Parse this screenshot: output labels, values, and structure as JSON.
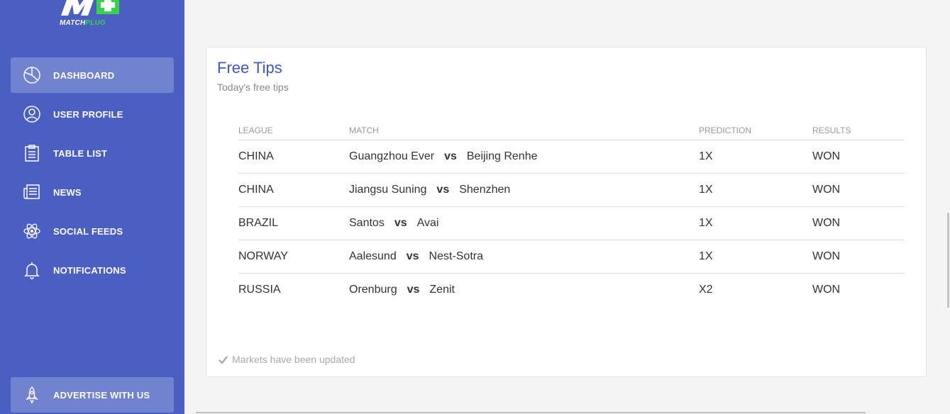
{
  "brand": {
    "logo_letters": "M",
    "name_part1": "MATCH",
    "name_part2": "PLUG"
  },
  "sidebar": {
    "items": [
      {
        "label": "DASHBOARD",
        "icon": "pie-chart-icon",
        "active": true
      },
      {
        "label": "USER PROFILE",
        "icon": "user-icon",
        "active": false
      },
      {
        "label": "TABLE LIST",
        "icon": "clipboard-icon",
        "active": false
      },
      {
        "label": "NEWS",
        "icon": "newspaper-icon",
        "active": false
      },
      {
        "label": "SOCIAL FEEDS",
        "icon": "atom-icon",
        "active": false
      },
      {
        "label": "NOTIFICATIONS",
        "icon": "bell-icon",
        "active": false
      }
    ],
    "advertise": {
      "label": "ADVERTISE WITH US",
      "icon": "rocket-icon"
    }
  },
  "card": {
    "title": "Free Tips",
    "subtitle": "Today's free tips",
    "columns": [
      "LEAGUE",
      "MATCH",
      "PREDICTION",
      "RESULTS"
    ],
    "rows": [
      {
        "league": "CHINA",
        "home": "Guangzhou Ever",
        "vs": "vs",
        "away": "Beijing Renhe",
        "prediction": "1X",
        "result": "WON"
      },
      {
        "league": "CHINA",
        "home": "Jiangsu Suning",
        "vs": "vs",
        "away": "Shenzhen",
        "prediction": "1X",
        "result": "WON"
      },
      {
        "league": "BRAZIL",
        "home": "Santos",
        "vs": "vs",
        "away": "Avai",
        "prediction": "1X",
        "result": "WON"
      },
      {
        "league": "NORWAY",
        "home": "Aalesund",
        "vs": "vs",
        "away": "Nest-Sotra",
        "prediction": "1X",
        "result": "WON"
      },
      {
        "league": "RUSSIA",
        "home": "Orenburg",
        "vs": "vs",
        "away": "Zenit",
        "prediction": "X2",
        "result": "WON"
      }
    ],
    "footer": "Markets have been updated"
  },
  "colors": {
    "sidebar": "#4a5fc1",
    "accent": "#3f57c0",
    "logo_green": "#33d44a"
  }
}
